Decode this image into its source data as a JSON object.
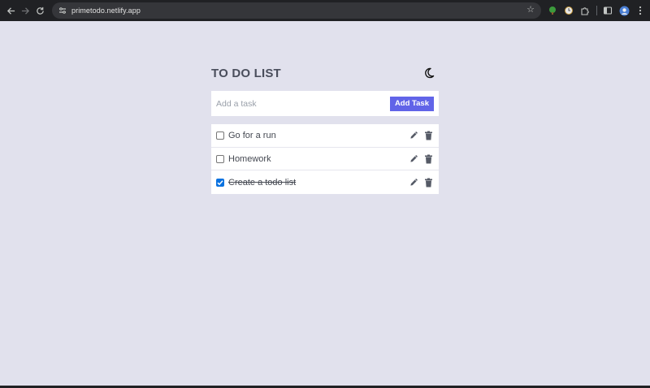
{
  "browser": {
    "url": "primetodo.netlify.app",
    "icons": [
      "back-arrow-icon",
      "forward-arrow-icon",
      "reload-icon",
      "tune-icon",
      "star-icon",
      "extension-icon",
      "puzzle-icon",
      "sidepanel-icon",
      "profile-icon",
      "kebab-menu-icon"
    ]
  },
  "app": {
    "title": "TO DO LIST",
    "theme_icon": "moon-icon",
    "form": {
      "placeholder": "Add a task",
      "add_label": "Add Task",
      "accent": "#6164e8"
    },
    "tasks": [
      {
        "text": "Go for a run",
        "done": false
      },
      {
        "text": "Homework",
        "done": false
      },
      {
        "text": "Create a todo list",
        "done": true
      }
    ],
    "action_icons": [
      "pencil-icon",
      "trash-icon"
    ]
  }
}
